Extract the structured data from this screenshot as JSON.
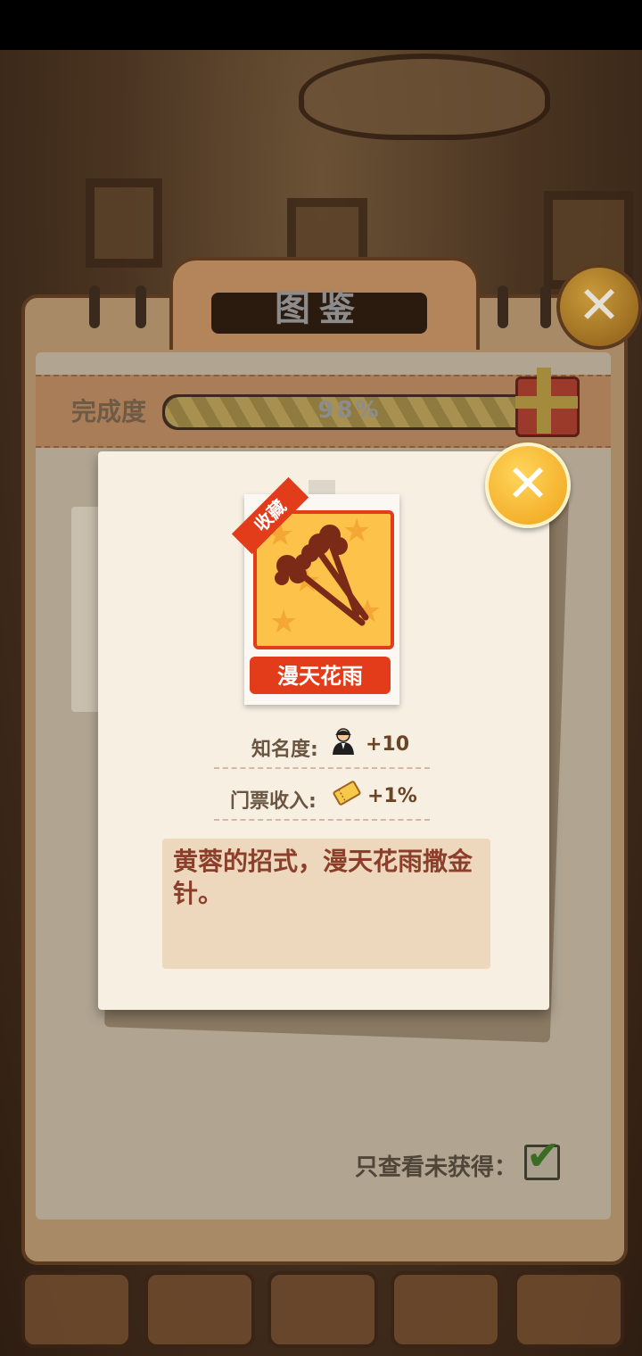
{
  "codex": {
    "title": "图鉴",
    "progress_label": "完成度",
    "progress_percent": 98,
    "progress_text": "98%",
    "filter_label": "只查看未获得：",
    "filter_checked": true,
    "close_icon": "close-icon"
  },
  "item_detail": {
    "badge": "收藏",
    "name": "漫天花雨",
    "stats": [
      {
        "label": "知名度:",
        "icon": "fame-person-icon",
        "value": "+10"
      },
      {
        "label": "门票收入:",
        "icon": "ticket-icon",
        "value": "+1%"
      }
    ],
    "description": "黄蓉的招式，漫天花雨撒金针。",
    "close_icon": "close-icon"
  },
  "colors": {
    "accent_red": "#e23c1b",
    "close_gold": "#f0a21a",
    "card_bg": "#f6efe2"
  }
}
